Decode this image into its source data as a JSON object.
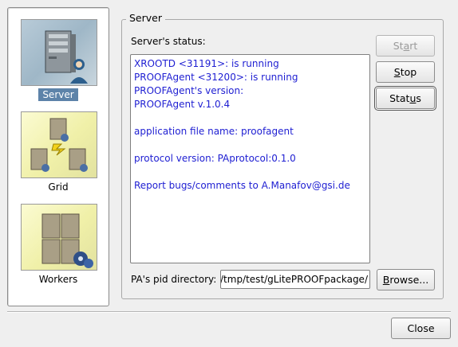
{
  "nav": {
    "items": [
      {
        "label": "Server",
        "icon": "server-user-icon",
        "selected": true
      },
      {
        "label": "Grid",
        "icon": "grid-network-icon",
        "selected": false
      },
      {
        "label": "Workers",
        "icon": "workers-cluster-icon",
        "selected": false
      }
    ]
  },
  "server": {
    "group_title": "Server",
    "status_label": "Server's status:",
    "status_lines": [
      "XROOTD <31191>: is running",
      "PROOFAgent <31200>: is running",
      "PROOFAgent's version:",
      "PROOFAgent v.1.0.4",
      "",
      "application file name: proofagent",
      "",
      "protocol version: PAprotocol:0.1.0",
      "",
      "Report bugs/comments to A.Manafov@gsi.de"
    ],
    "buttons": {
      "start_pre": "St",
      "start_mn": "a",
      "start_post": "rt",
      "stop_pre": "",
      "stop_mn": "S",
      "stop_post": "top",
      "status_pre": "Stat",
      "status_mn": "u",
      "status_post": "s"
    },
    "pid_label": "PA's pid directory:",
    "pid_value": "/tmp/test/gLitePROOFpackage/",
    "browse_pre": "",
    "browse_mn": "B",
    "browse_post": "rowse..."
  },
  "footer": {
    "close_label": "Close"
  },
  "colors": {
    "status_text": "#1e1ed2",
    "selection": "#5d83a9"
  }
}
